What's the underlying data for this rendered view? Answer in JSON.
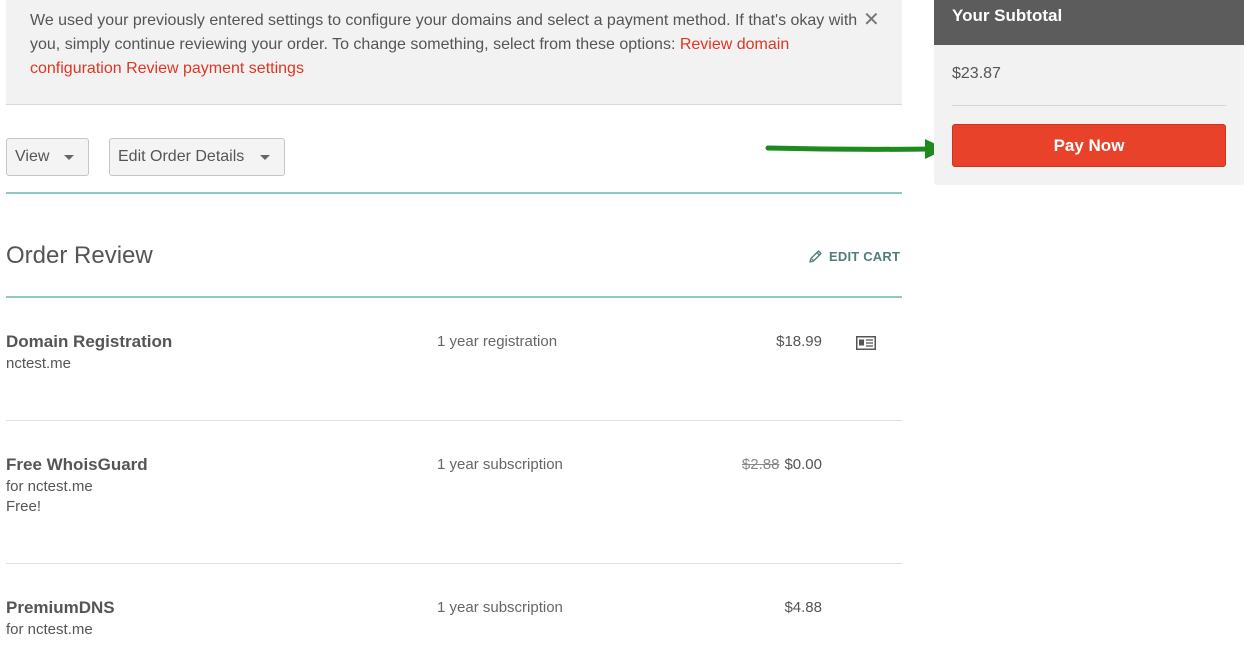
{
  "notice": {
    "message": "We used your previously entered settings to configure your domains and select a payment method. If that's okay with you, simply continue reviewing your order. To change something, select from these options: ",
    "link_domain": "Review domain configuration",
    "link_payment": "Review payment settings",
    "close_glyph": "✕"
  },
  "toolbar": {
    "view_label": "View",
    "edit_order_label": "Edit Order Details"
  },
  "order": {
    "title": "Order Review",
    "edit_cart_label": "EDIT CART",
    "items": [
      {
        "name": "Domain Registration",
        "sub1": "nctest.me",
        "sub2": "",
        "term": "1 year registration",
        "old_price": "",
        "price": "$18.99"
      },
      {
        "name": "Free WhoisGuard",
        "sub1": "for nctest.me",
        "sub2": "Free!",
        "term": "1 year subscription",
        "old_price": "$2.88",
        "price": "$0.00"
      },
      {
        "name": "PremiumDNS",
        "sub1": "for nctest.me",
        "sub2": "",
        "term": "1 year subscription",
        "old_price": "",
        "price": "$4.88"
      }
    ]
  },
  "subtotal": {
    "header": "Your Subtotal",
    "amount": "$23.87",
    "pay_label": "Pay Now"
  },
  "icons": {
    "close": "close-icon",
    "caret": "chevron-down-icon",
    "pencil": "pencil-icon",
    "contact_card": "contact-card-icon",
    "arrow": "green-arrow-annotation"
  },
  "colors": {
    "accent_red": "#e8432a",
    "link_red": "#de3723",
    "teal_rule": "#8cc9c3",
    "header_grey": "#5c5c5c",
    "arrow_green": "#1e8a1e"
  }
}
